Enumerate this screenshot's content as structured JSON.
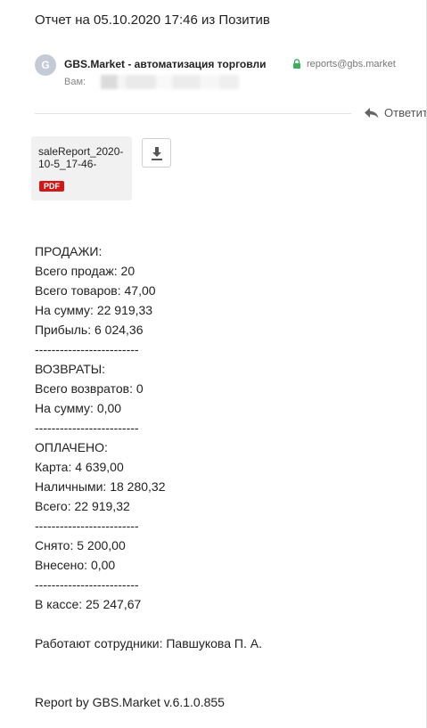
{
  "email": {
    "subject": "Отчет на 05.10.2020 17:46 из Позитив",
    "avatar_letter": "G",
    "sender_name": "GBS.Market - автоматизация торговли",
    "sender_email": "reports@gbs.market",
    "to_label": "Вам:",
    "reply_label": "Ответить"
  },
  "attachment": {
    "name": "saleReport_2020-10-5_17-46-",
    "type_badge": "PDF"
  },
  "body": {
    "sales_header": "ПРОДАЖИ:",
    "total_sales": "Всего продаж: 20",
    "total_items": "Всего товаров: 47,00",
    "sales_amount": "На сумму: 22 919,33",
    "profit": "Прибыль: 6 024,36",
    "sep1": "-------------------------",
    "returns_header": "ВОЗВРАТЫ:",
    "total_returns": "Всего возвратов: 0",
    "returns_amount": "На сумму: 0,00",
    "sep2": "-------------------------",
    "paid_header": "ОПЛАЧЕНО:",
    "card": "Карта: 4 639,00",
    "cash": "Наличными: 18 280,32",
    "paid_total": "Всего: 22 919,32",
    "sep3": "-------------------------",
    "withdrawn": "Снято: 5 200,00",
    "deposited": "Внесено: 0,00",
    "sep4": "-------------------------",
    "in_register": "В кассе: 25 247,67",
    "employees": "Работают сотрудники: Павшукова П. А.",
    "footer": "Report by GBS.Market v.6.1.0.855"
  },
  "colors": {
    "pdf_badge": "#d01818",
    "lock": "#3dae5c",
    "attachment_bg": "#f1f1f1"
  },
  "icons": [
    "lock-icon",
    "reply-icon",
    "download-icon"
  ]
}
